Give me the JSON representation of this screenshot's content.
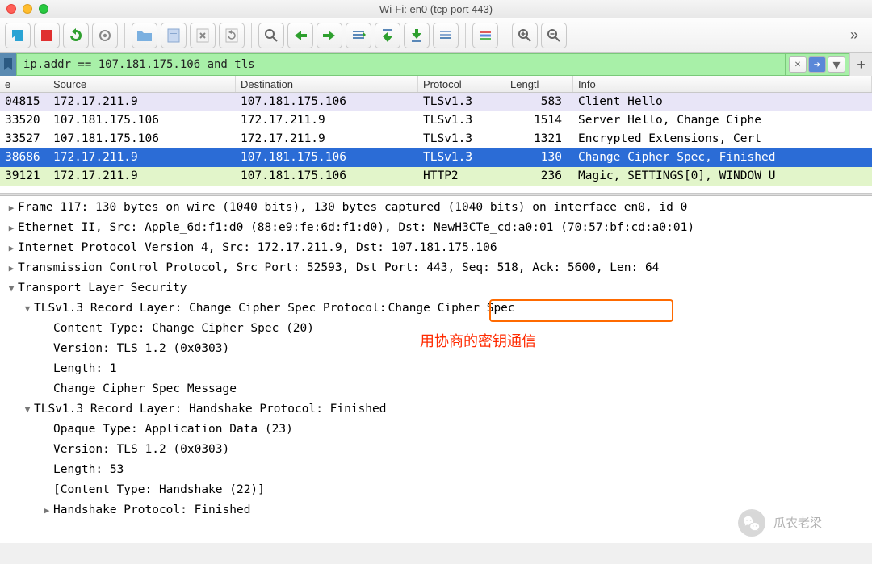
{
  "window": {
    "title": "Wi-Fi: en0 (tcp port 443)"
  },
  "filter": {
    "value": "ip.addr == 107.181.175.106 and tls"
  },
  "headers": {
    "time": "e",
    "source": "Source",
    "destination": "Destination",
    "protocol": "Protocol",
    "length": "Lengtl",
    "info": "Info"
  },
  "packets": [
    {
      "cls": "r1",
      "time": "04815",
      "src": "172.17.211.9",
      "dst": "107.181.175.106",
      "proto": "TLSv1.3",
      "len": "583",
      "info": "Client Hello"
    },
    {
      "cls": "r2",
      "time": "33520",
      "src": "107.181.175.106",
      "dst": "172.17.211.9",
      "proto": "TLSv1.3",
      "len": "1514",
      "info": "Server Hello, Change Ciphe"
    },
    {
      "cls": "r2",
      "time": "33527",
      "src": "107.181.175.106",
      "dst": "172.17.211.9",
      "proto": "TLSv1.3",
      "len": "1321",
      "info": "Encrypted Extensions, Cert"
    },
    {
      "cls": "sel",
      "time": "38686",
      "src": "172.17.211.9",
      "dst": "107.181.175.106",
      "proto": "TLSv1.3",
      "len": "130",
      "info": "Change Cipher Spec, Finished"
    },
    {
      "cls": "r5",
      "time": "39121",
      "src": "172.17.211.9",
      "dst": "107.181.175.106",
      "proto": "HTTP2",
      "len": "236",
      "info": "Magic, SETTINGS[0], WINDOW_U"
    }
  ],
  "tree": {
    "frame": "Frame 117: 130 bytes on wire (1040 bits), 130 bytes captured (1040 bits) on interface en0, id 0",
    "eth": "Ethernet II, Src: Apple_6d:f1:d0 (88:e9:fe:6d:f1:d0), Dst: NewH3CTe_cd:a0:01 (70:57:bf:cd:a0:01)",
    "ip": "Internet Protocol Version 4, Src: 172.17.211.9, Dst: 107.181.175.106",
    "tcp": "Transmission Control Protocol, Src Port: 52593, Dst Port: 443, Seq: 518, Ack: 5600, Len: 64",
    "tls": "Transport Layer Security",
    "rec1": "TLSv1.3 Record Layer: Change Cipher Spec Protocol: ",
    "rec1_hl": "Change Cipher Spec",
    "ct": "Content Type: Change Cipher Spec (20)",
    "ver1": "Version: TLS 1.2 (0x0303)",
    "len1": "Length: 1",
    "msg": "Change Cipher Spec Message",
    "rec2": "TLSv1.3 Record Layer: Handshake Protocol: Finished",
    "ot": "Opaque Type: Application Data (23)",
    "ver2": "Version: TLS 1.2 (0x0303)",
    "len2": "Length: 53",
    "ct2": "[Content Type: Handshake (22)]",
    "hs": "Handshake Protocol: Finished"
  },
  "annotation": "用协商的密钥通信",
  "watermark": "瓜农老梁"
}
